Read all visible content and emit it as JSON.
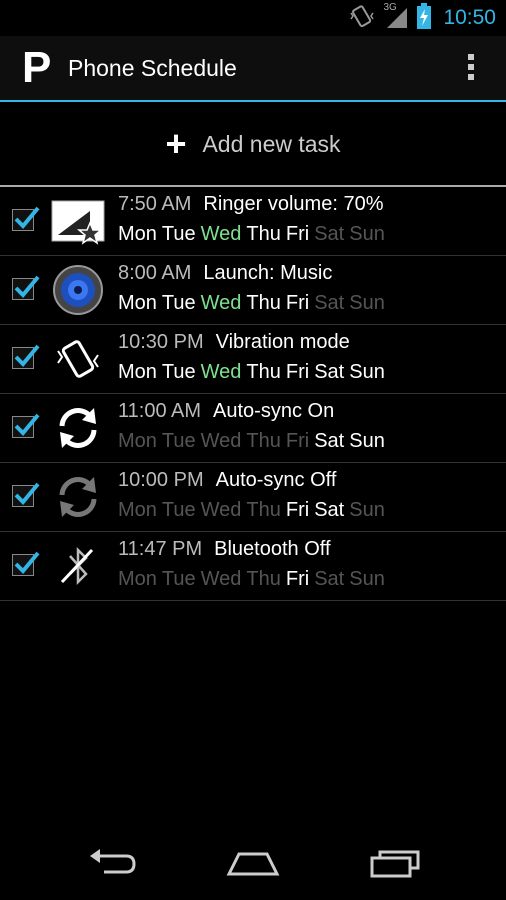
{
  "status": {
    "time": "10:50",
    "network": "3G"
  },
  "app": {
    "logo": "P",
    "title": "Phone Schedule",
    "menu_icon": "overflow-menu-icon"
  },
  "add_task": {
    "label": "Add new task",
    "icon": "plus-icon"
  },
  "colors": {
    "accent": "#33b5e5",
    "today": "#7ee08f",
    "active_day": "#ffffff",
    "inactive_day": "#555555"
  },
  "tasks": [
    {
      "checked": true,
      "icon": "ringer-volume-icon",
      "time": "7:50 AM",
      "title": "Ringer volume: 70%",
      "days": [
        {
          "label": "Mon",
          "state": "on"
        },
        {
          "label": "Tue",
          "state": "on"
        },
        {
          "label": "Wed",
          "state": "today"
        },
        {
          "label": "Thu",
          "state": "on"
        },
        {
          "label": "Fri",
          "state": "on"
        },
        {
          "label": "Sat",
          "state": "off"
        },
        {
          "label": "Sun",
          "state": "off"
        }
      ]
    },
    {
      "checked": true,
      "icon": "speaker-music-icon",
      "time": "8:00 AM",
      "title": "Launch: Music",
      "days": [
        {
          "label": "Mon",
          "state": "on"
        },
        {
          "label": "Tue",
          "state": "on"
        },
        {
          "label": "Wed",
          "state": "today"
        },
        {
          "label": "Thu",
          "state": "on"
        },
        {
          "label": "Fri",
          "state": "on"
        },
        {
          "label": "Sat",
          "state": "off"
        },
        {
          "label": "Sun",
          "state": "off"
        }
      ]
    },
    {
      "checked": true,
      "icon": "vibration-icon",
      "time": "10:30 PM",
      "title": "Vibration mode",
      "days": [
        {
          "label": "Mon",
          "state": "on"
        },
        {
          "label": "Tue",
          "state": "on"
        },
        {
          "label": "Wed",
          "state": "today"
        },
        {
          "label": "Thu",
          "state": "on"
        },
        {
          "label": "Fri",
          "state": "on"
        },
        {
          "label": "Sat",
          "state": "on"
        },
        {
          "label": "Sun",
          "state": "on"
        }
      ]
    },
    {
      "checked": true,
      "icon": "sync-on-icon",
      "time": "11:00 AM",
      "title": "Auto-sync On",
      "days": [
        {
          "label": "Mon",
          "state": "off"
        },
        {
          "label": "Tue",
          "state": "off"
        },
        {
          "label": "Wed",
          "state": "off"
        },
        {
          "label": "Thu",
          "state": "off"
        },
        {
          "label": "Fri",
          "state": "off"
        },
        {
          "label": "Sat",
          "state": "on"
        },
        {
          "label": "Sun",
          "state": "on"
        }
      ]
    },
    {
      "checked": true,
      "icon": "sync-off-icon",
      "time": "10:00 PM",
      "title": "Auto-sync Off",
      "days": [
        {
          "label": "Mon",
          "state": "off"
        },
        {
          "label": "Tue",
          "state": "off"
        },
        {
          "label": "Wed",
          "state": "off"
        },
        {
          "label": "Thu",
          "state": "off"
        },
        {
          "label": "Fri",
          "state": "on"
        },
        {
          "label": "Sat",
          "state": "on"
        },
        {
          "label": "Sun",
          "state": "off"
        }
      ]
    },
    {
      "checked": true,
      "icon": "bluetooth-off-icon",
      "time": "11:47 PM",
      "title": "Bluetooth Off",
      "days": [
        {
          "label": "Mon",
          "state": "off"
        },
        {
          "label": "Tue",
          "state": "off"
        },
        {
          "label": "Wed",
          "state": "off"
        },
        {
          "label": "Thu",
          "state": "off"
        },
        {
          "label": "Fri",
          "state": "on"
        },
        {
          "label": "Sat",
          "state": "off"
        },
        {
          "label": "Sun",
          "state": "off"
        }
      ]
    }
  ],
  "navbar": {
    "back_icon": "back-icon",
    "home_icon": "home-icon",
    "recents_icon": "recent-apps-icon"
  }
}
